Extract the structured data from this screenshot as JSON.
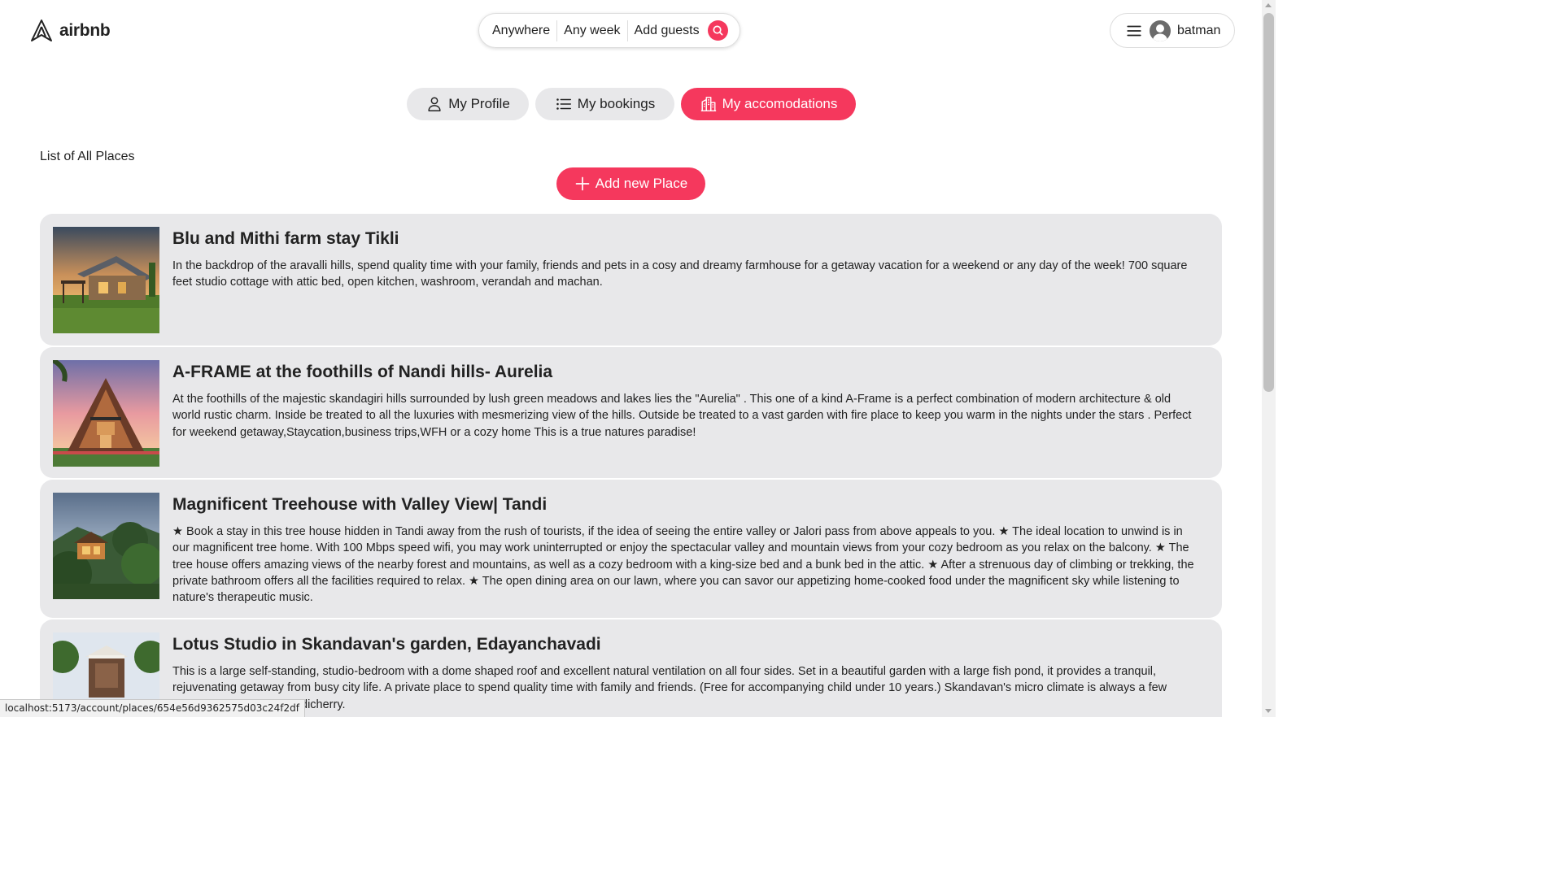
{
  "header": {
    "logo_text": "airbnb",
    "search": {
      "anywhere": "Anywhere",
      "any_week": "Any week",
      "add_guests": "Add guests"
    },
    "user": {
      "name": "batman"
    }
  },
  "tabs": {
    "profile": "My Profile",
    "bookings": "My bookings",
    "accommodations": "My accomodations",
    "active": "accommodations"
  },
  "main": {
    "list_title": "List of All Places",
    "add_button": "Add new Place"
  },
  "places": [
    {
      "title": "Blu and Mithi farm stay Tikli",
      "description": "In the backdrop of the aravalli hills, spend quality time with your family, friends and pets in a cosy and dreamy farmhouse for a getaway vacation for a weekend or any day of the week! 700 square feet studio cottage with attic bed, open kitchen, washroom, verandah and machan."
    },
    {
      "title": "A-FRAME at the foothills of Nandi hills- Aurelia",
      "description": "At the foothills of the majestic skandagiri hills surrounded by lush green meadows and lakes lies the \"Aurelia\" . This one of a kind A-Frame is a perfect combination of modern architecture & old world rustic charm. Inside be treated to all the luxuries with mesmerizing view of the hills. Outside be treated to a vast garden with fire place to keep you warm in the nights under the stars . Perfect for weekend getaway,Staycation,business trips,WFH or a cozy home This is a true natures paradise!"
    },
    {
      "title": "Magnificent Treehouse with Valley View| Tandi",
      "description": "★ Book a stay in this tree house hidden in Tandi away from the rush of tourists, if the idea of seeing the entire valley or Jalori pass from above appeals to you. ★ The ideal location to unwind is in our magnificent tree home. With 100 Mbps speed wifi, you may work uninterrupted or enjoy the spectacular valley and mountain views from your cozy bedroom as you relax on the balcony. ★ The tree house offers amazing views of the nearby forest and mountains, as well as a cozy bedroom with a king-size bed and a bunk bed in the attic. ★ After a strenuous day of climbing or trekking, the private bathroom offers all the facilities required to relax. ★ The open dining area on our lawn, where you can savor our appetizing home-cooked food under the magnificent sky while listening to nature's therapeutic music."
    },
    {
      "title": "Lotus Studio in Skandavan's garden, Edayanchavadi",
      "description": "This is a large self-standing, studio-bedroom with a dome shaped roof and excellent natural ventilation on all four sides. Set in a beautiful garden with a large fish pond, it provides a tranquil, rejuvenating getaway from busy city life. A private place to spend quality time with family and friends. (Free for accompanying child under 10 years.) Skandavan's micro climate is always a few degrees cooler than Pondicherry."
    }
  ],
  "status_bar": {
    "url": "localhost:5173/account/places/654e56d9362575d03c24f2df"
  },
  "colors": {
    "accent": "#f5385d",
    "card_bg": "#e8e8ea",
    "tab_bg": "#e8e8ea"
  }
}
